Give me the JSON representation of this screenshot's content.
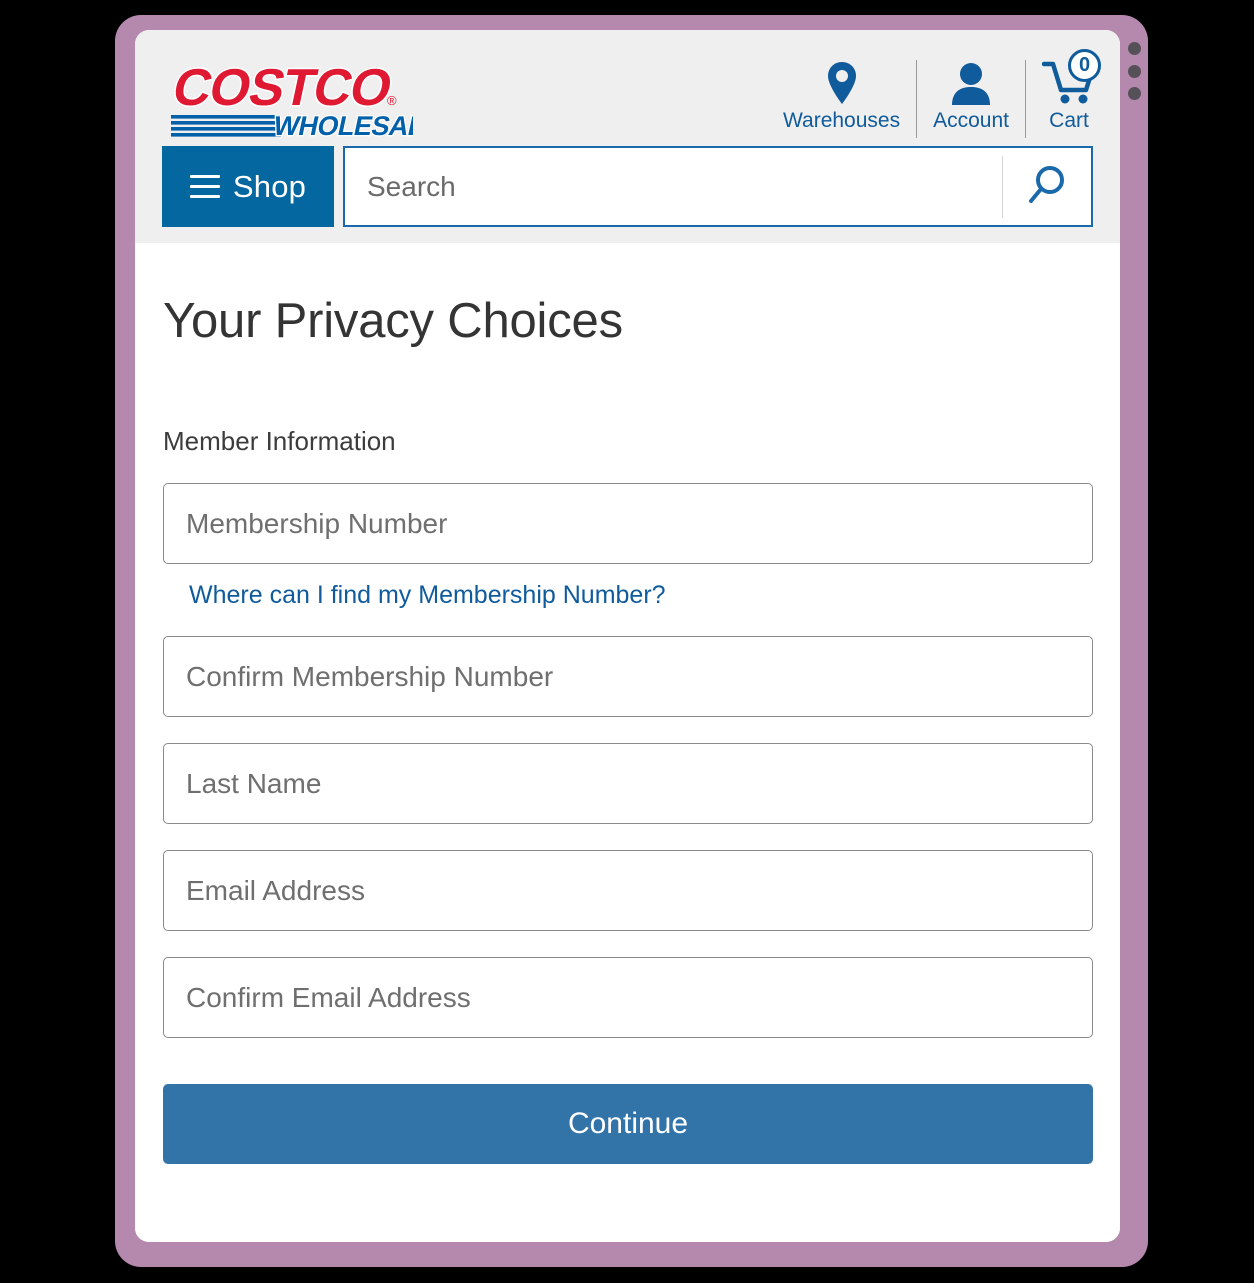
{
  "brand": {
    "logo_primary": "COSTCO",
    "logo_secondary": "WHOLESALE",
    "logo_primary_color": "#e01933",
    "logo_secondary_color": "#0060a9",
    "accent_blue": "#0f5b9c",
    "shop_blue": "#0567a0",
    "button_blue": "#3274a8",
    "frame_purple": "#b489ad",
    "header_gray": "#efefef"
  },
  "header": {
    "nav": [
      {
        "label": "Warehouses",
        "icon": "map-pin-icon"
      },
      {
        "label": "Account",
        "icon": "person-icon"
      },
      {
        "label": "Cart",
        "icon": "shopping-cart-icon",
        "badge": "0"
      }
    ],
    "shop_label": "Shop",
    "search": {
      "placeholder": "Search",
      "value": "",
      "icon": "magnifier-icon"
    }
  },
  "main": {
    "page_title": "Your Privacy Choices",
    "section_title": "Member Information",
    "fields": [
      {
        "name": "membership-number",
        "placeholder": "Membership Number",
        "value": ""
      },
      {
        "name": "confirm-membership-number",
        "placeholder": "Confirm Membership Number",
        "value": ""
      },
      {
        "name": "last-name",
        "placeholder": "Last Name",
        "value": ""
      },
      {
        "name": "email-address",
        "placeholder": "Email Address",
        "value": ""
      },
      {
        "name": "confirm-email-address",
        "placeholder": "Confirm Email Address",
        "value": ""
      }
    ],
    "help_link": "Where can I find my Membership Number?",
    "submit_label": "Continue"
  }
}
